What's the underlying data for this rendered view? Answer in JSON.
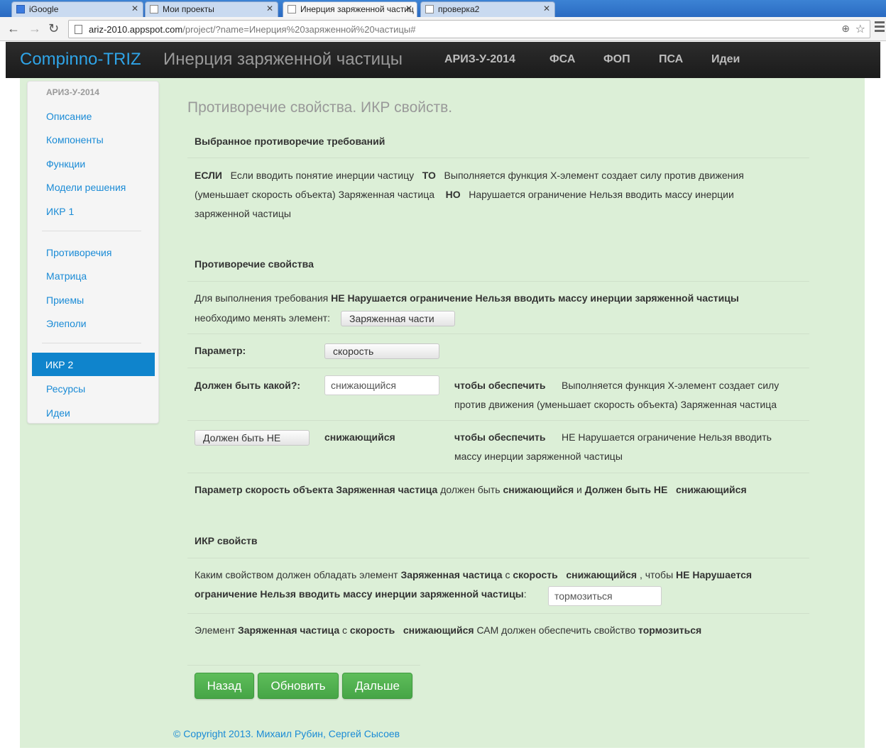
{
  "browser": {
    "tabs": [
      {
        "label": "iGoogle"
      },
      {
        "label": "Мои проекты"
      },
      {
        "label": "Инерция заряженной частиц"
      },
      {
        "label": "проверка2"
      }
    ],
    "url_host": "ariz-2010.appspot.com",
    "url_path": "/project/?name=Инерция%20заряженной%20частицы#"
  },
  "navbar": {
    "brand": "Compinno-TRIZ",
    "project_title": "Инерция заряженной частицы",
    "links": [
      "АРИЗ-У-2014",
      "ФСА",
      "ФОП",
      "ПСА",
      "Идеи"
    ]
  },
  "sidebar": {
    "header": "АРИЗ-У-2014",
    "group1": [
      "Описание",
      "Компоненты",
      "Функции",
      "Модели решения",
      "ИКР 1"
    ],
    "group2": [
      "Противоречия",
      "Матрица",
      "Приемы",
      "Элеполи"
    ],
    "active": "ИКР 2",
    "group3": [
      "Ресурсы",
      "Идеи"
    ]
  },
  "content": {
    "title": "Противоречие свойства. ИКР свойств.",
    "selected_heading": "Выбранное противоречие требований",
    "if_label": "ЕСЛИ",
    "if_text": "Если вводить понятие инерции частицу",
    "then_label": "ТО",
    "then_text": "Выполняется функция Х-элемент создает силу против движения",
    "then_text_2": "(уменьшает скорость объекта) Заряженная частица",
    "but_label": "НО",
    "but_text": "Нарушается ограничение Нельзя вводить массу инерции",
    "but_text_2": "заряженной частицы",
    "property_heading": "Противоречие свойства",
    "req_prefix": "Для выполнения требования",
    "req_bold": "НЕ Нарушается ограничение Нельзя вводить массу инерции заряженной частицы",
    "change_element_label": "необходимо менять элемент:",
    "element_button": "Заряженная части",
    "param_label": "Параметр:",
    "param_button": "скорость",
    "should_be_label": "Должен быть какой?:",
    "should_be_value": "снижающийся",
    "to_ensure_label": "чтобы обеспечить",
    "to_ensure_text_1": "Выполняется функция Х-элемент создает силу",
    "to_ensure_text_2": "против движения (уменьшает скорость объекта) Заряженная частица",
    "should_not_button": "Должен быть НЕ",
    "should_not_value": "снижающийся",
    "to_ensure_label_2": "чтобы обеспечить",
    "to_ensure_not_1": "НЕ Нарушается ограничение Нельзя вводить",
    "to_ensure_not_2": "массу инерции заряженной частицы",
    "summary_b1": "Параметр скорость объекта Заряженная частица",
    "summary_t1": "должен быть",
    "summary_b2": "снижающийся",
    "summary_t2": "и",
    "summary_b3": "Должен быть НЕ   снижающийся",
    "ikr_heading": "ИКР свойств",
    "ikr_t1": "Каким свойством должен обладать элемент",
    "ikr_b1": "Заряженная частица",
    "ikr_t2": "с",
    "ikr_b2": "скорость   снижающийся",
    "ikr_t3": ", чтобы",
    "ikr_b3": "НЕ Нарушается",
    "ikr_b4": "ограничение Нельзя вводить массу инерции заряженной частицы",
    "ikr_t4": ":",
    "ikr_input": "тормозиться",
    "final_t1": "Элемент",
    "final_b1": "Заряженная частица",
    "final_t2": "с",
    "final_b2": "скорость   снижающийся",
    "final_t3": "САМ должен обеспечить свойство",
    "final_b3": "тормозиться"
  },
  "buttons": {
    "back": "Назад",
    "update": "Обновить",
    "next": "Дальше"
  },
  "footer": "© Copyright 2013. Михаил Рубин, Сергей Сысоев",
  "colors": {
    "accent": "#2fa4e7",
    "link": "#1a8bd6",
    "active_bg": "#0f84cc",
    "page_bg": "#dcefd7",
    "btn_green": "#46a546",
    "navbar": "#1b1b1b"
  }
}
